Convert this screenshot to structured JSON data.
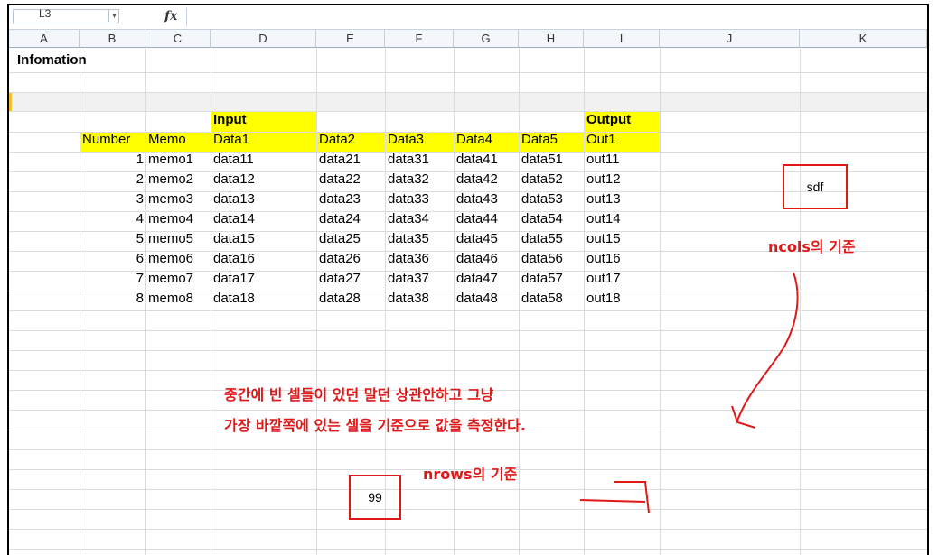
{
  "formula_bar": {
    "name_box": "L3",
    "dropdown_glyph": "▾",
    "fx_label": "fx"
  },
  "columns": [
    "A",
    "B",
    "C",
    "D",
    "E",
    "F",
    "G",
    "H",
    "I",
    "J",
    "K"
  ],
  "sheet": {
    "title": "Infomation",
    "group_labels": {
      "input": "Input",
      "output": "Output"
    },
    "headers": [
      "Number",
      "Memo",
      "Data1",
      "Data2",
      "Data3",
      "Data4",
      "Data5",
      "Out1"
    ],
    "rows": [
      [
        "1",
        "memo1",
        "data11",
        "data21",
        "data31",
        "data41",
        "data51",
        "out11"
      ],
      [
        "2",
        "memo2",
        "data12",
        "data22",
        "data32",
        "data42",
        "data52",
        "out12"
      ],
      [
        "3",
        "memo3",
        "data13",
        "data23",
        "data33",
        "data43",
        "data53",
        "out13"
      ],
      [
        "4",
        "memo4",
        "data14",
        "data24",
        "data34",
        "data44",
        "data54",
        "out14"
      ],
      [
        "5",
        "memo5",
        "data15",
        "data25",
        "data35",
        "data45",
        "data55",
        "out15"
      ],
      [
        "6",
        "memo6",
        "data16",
        "data26",
        "data36",
        "data46",
        "data56",
        "out16"
      ],
      [
        "7",
        "memo7",
        "data17",
        "data27",
        "data37",
        "data47",
        "data57",
        "out17"
      ],
      [
        "8",
        "memo8",
        "data18",
        "data28",
        "data38",
        "data48",
        "data58",
        "out18"
      ]
    ],
    "cell_k_value": "sdf",
    "cell_e_value": "99",
    "highlight_color": "#ffff00"
  },
  "annotations": {
    "ncols_label": "ncols의 기준",
    "nrows_label": "nrows의 기준",
    "note_line1": "중간에 빈 셀들이 있던 말던 상관안하고 그냥",
    "note_line2": "가장 바깥쪽에 있는 셀을 기준으로 값을 측정한다.",
    "color": "#e01818"
  }
}
